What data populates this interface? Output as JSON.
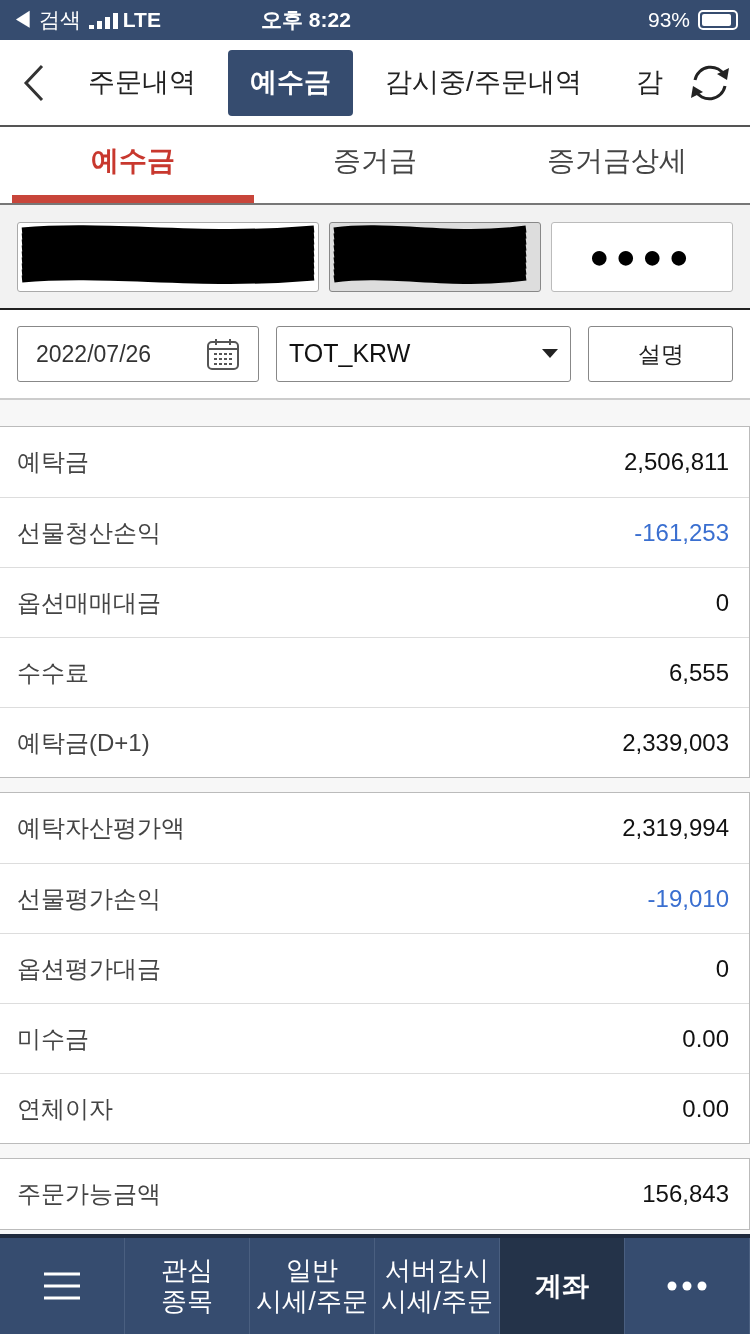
{
  "status_bar": {
    "back_label": "◀ 검색",
    "network": "LTE",
    "time": "오후 8:22",
    "battery": "93%"
  },
  "top_tabs": [
    {
      "label": "주문내역",
      "selected": false
    },
    {
      "label": "예수금",
      "selected": true
    },
    {
      "label": "감시중/주문내역",
      "selected": false
    },
    {
      "label": "감",
      "selected": false
    }
  ],
  "sub_tabs": [
    {
      "label": "예수금",
      "selected": true
    },
    {
      "label": "증거금",
      "selected": false
    },
    {
      "label": "증거금상세",
      "selected": false
    }
  ],
  "account": {
    "password": "●●●●"
  },
  "filters": {
    "date": "2022/07/26",
    "currency": "TOT_KRW",
    "help_button": "설명"
  },
  "groups": [
    [
      {
        "label": "예탁금",
        "value": "2,506,811",
        "color": "#111111"
      },
      {
        "label": "선물청산손익",
        "value": "-161,253",
        "color": "#3a6fd0"
      },
      {
        "label": "옵션매매대금",
        "value": "0",
        "color": "#111111"
      },
      {
        "label": "수수료",
        "value": "6,555",
        "color": "#111111"
      },
      {
        "label": "예탁금(D+1)",
        "value": "2,339,003",
        "color": "#111111"
      }
    ],
    [
      {
        "label": "예탁자산평가액",
        "value": "2,319,994",
        "color": "#111111"
      },
      {
        "label": "선물평가손익",
        "value": "-19,010",
        "color": "#3a6fd0"
      },
      {
        "label": "옵션평가대금",
        "value": "0",
        "color": "#111111"
      },
      {
        "label": "미수금",
        "value": "0.00",
        "color": "#111111"
      },
      {
        "label": "연체이자",
        "value": "0.00",
        "color": "#111111"
      }
    ],
    [
      {
        "label": "주문가능금액",
        "value": "156,843",
        "color": "#111111"
      }
    ]
  ],
  "bottom_nav": [
    {
      "kind": "menu",
      "selected": false
    },
    {
      "kind": "text",
      "lines": [
        "관심",
        "종목"
      ],
      "selected": false
    },
    {
      "kind": "text",
      "lines": [
        "일반",
        "시세/주문"
      ],
      "selected": false
    },
    {
      "kind": "text",
      "lines": [
        "서버감시",
        "시세/주문"
      ],
      "selected": false
    },
    {
      "kind": "text",
      "lines": [
        "계좌"
      ],
      "selected": true
    },
    {
      "kind": "more",
      "selected": false
    }
  ]
}
